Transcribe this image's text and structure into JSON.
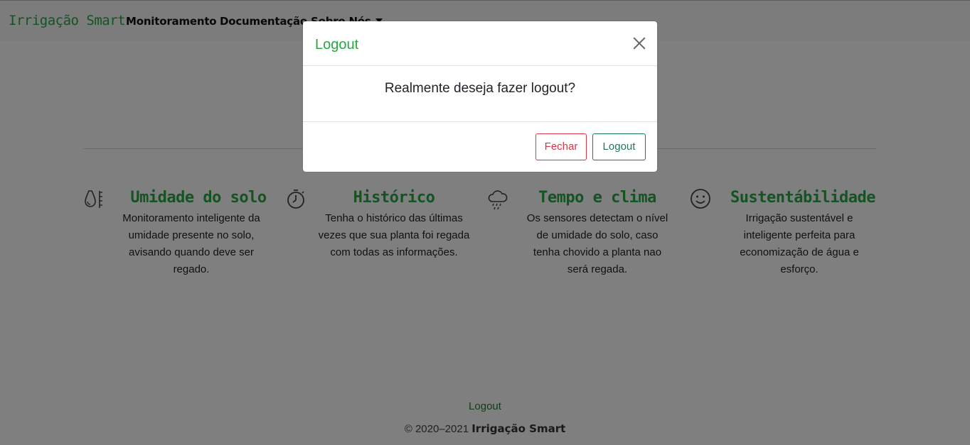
{
  "navbar": {
    "brand": "Irrigação Smart",
    "links": [
      "Monitoramento",
      "Documentação",
      "Sobre Nós"
    ]
  },
  "features": [
    {
      "icon": "droplet-icon",
      "title": "Umidade do solo",
      "text": "Monitoramento inteligente da umidade presente no solo, avisando quando deve ser regado."
    },
    {
      "icon": "stopwatch-icon",
      "title": "Histórico",
      "text": "Tenha o histórico das últimas vezes que sua planta foi regada com todas as informações."
    },
    {
      "icon": "cloud-rain-icon",
      "title": "Tempo e clima",
      "text": "Os sensores detectam o nível de umidade do solo, caso tenha chovido a planta nao será regada."
    },
    {
      "icon": "smile-icon",
      "title": "Sustentábilidade",
      "text": "Irrigação sustentável e inteligente perfeita para economização de água e esforço."
    }
  ],
  "footer": {
    "link": "Logout",
    "copy_prefix": "© 2020–2021",
    "copy_brand": "Irrigação Smart"
  },
  "modal": {
    "title": "Logout",
    "message": "Realmente deseja fazer logout?",
    "cancel_label": "Fechar",
    "confirm_label": "Logout"
  },
  "colors": {
    "brand_green": "#28a745",
    "danger": "#dc3545",
    "confirm": "#1f7a5a"
  }
}
